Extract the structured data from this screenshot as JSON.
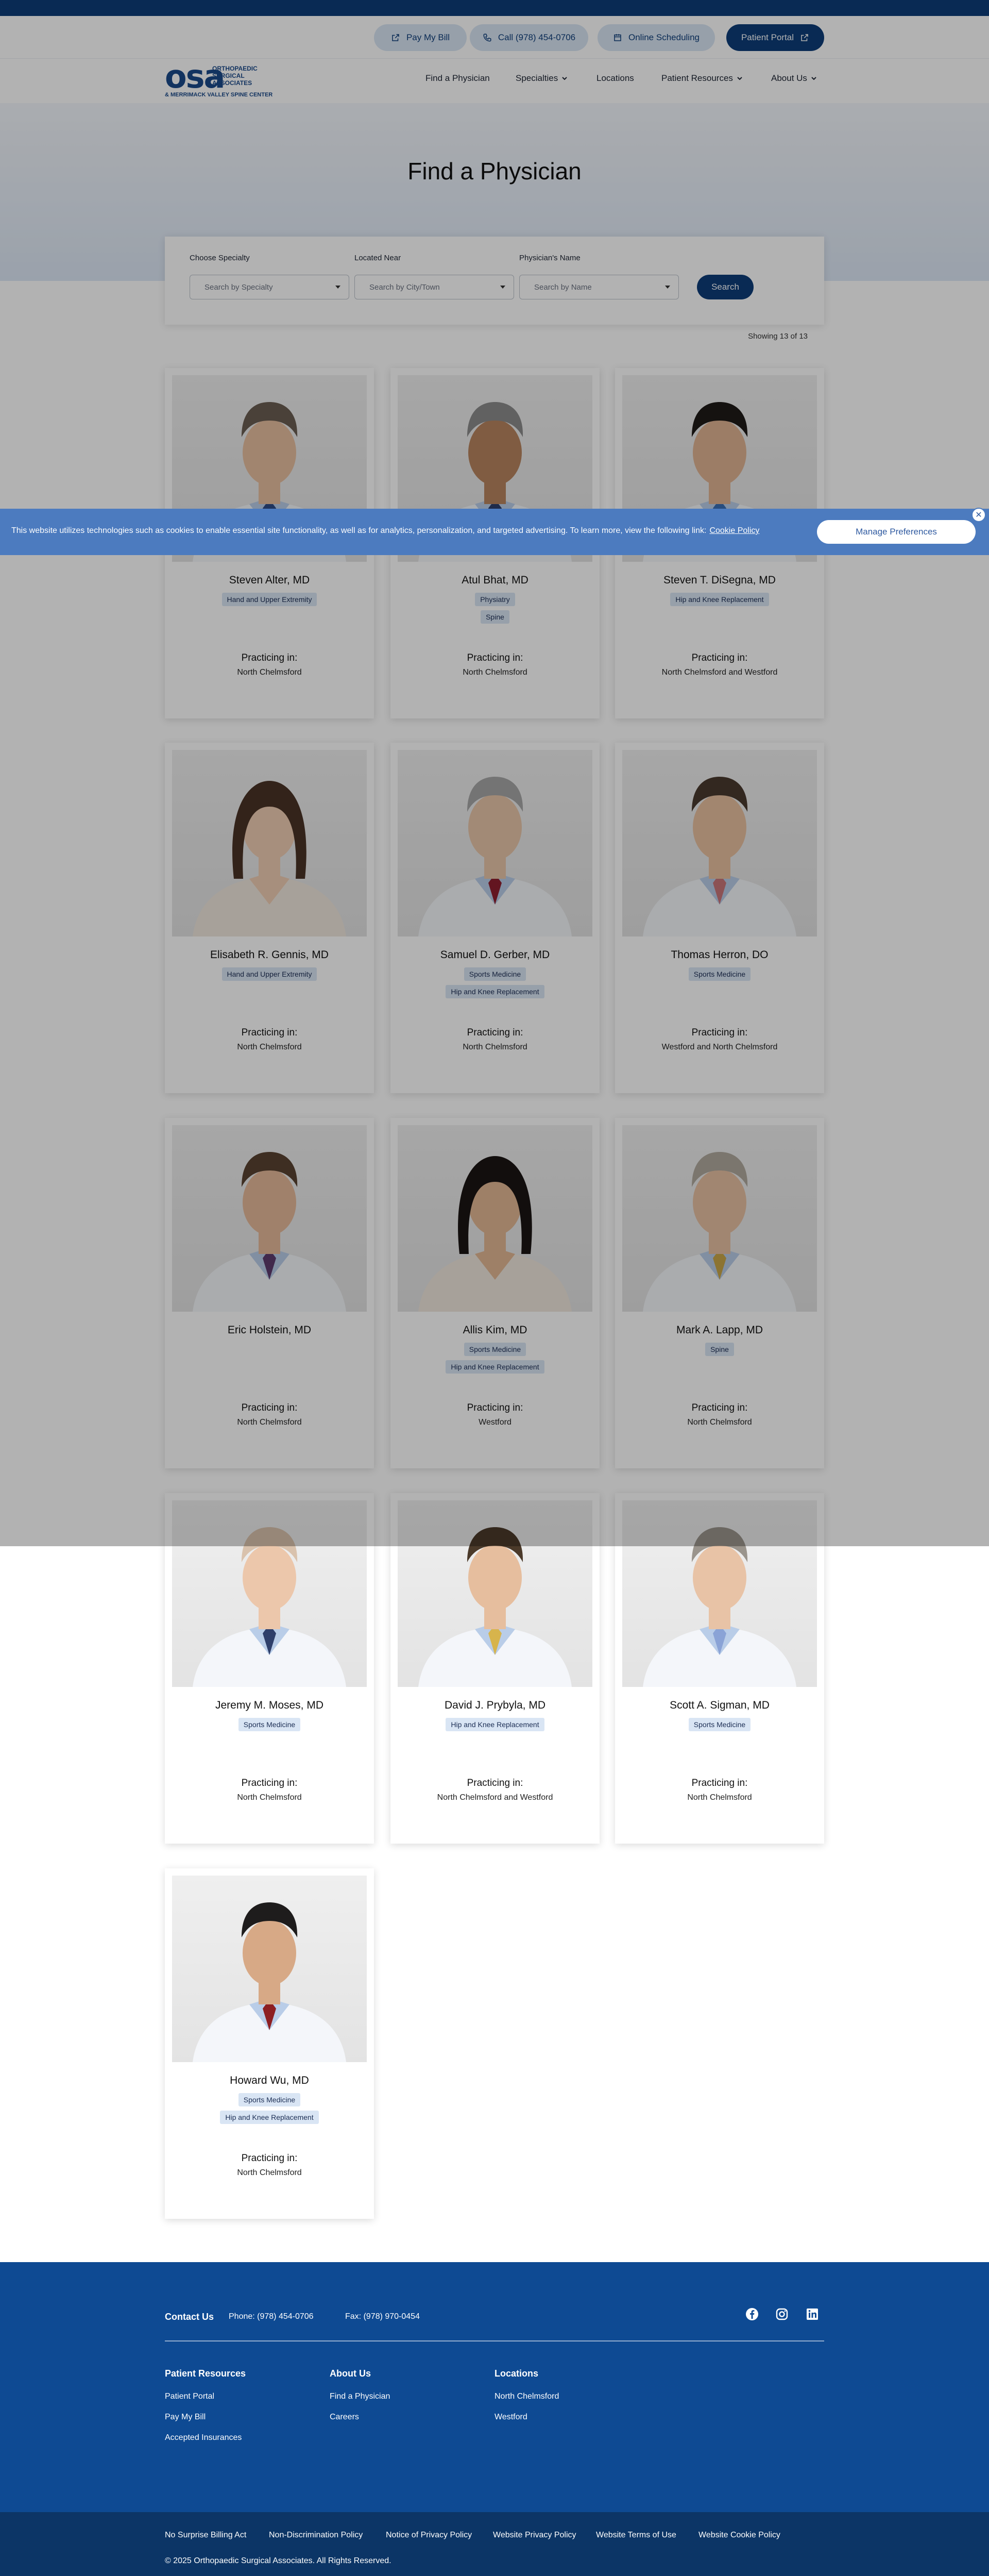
{
  "utility": {
    "pay_bill": "Pay My Bill",
    "call": "Call (978) 454-0706",
    "scheduling": "Online Scheduling",
    "portal": "Patient Portal"
  },
  "logo": {
    "mark": "osa",
    "line1": "ORTHOPAEDIC",
    "line2": "SURGICAL",
    "line3": "ASSOCIATES",
    "sub": "& MERRIMACK VALLEY SPINE CENTER"
  },
  "nav": {
    "find": "Find a Physician",
    "specialties": "Specialties",
    "locations": "Locations",
    "resources": "Patient Resources",
    "about": "About Us"
  },
  "hero": {
    "title": "Find a Physician"
  },
  "filters": {
    "specialty_label": "Choose Specialty",
    "specialty_placeholder": "Search by Specialty",
    "location_label": "Located Near",
    "location_placeholder": "Search by City/Town",
    "name_label": "Physician's Name",
    "name_placeholder": "Search by Name",
    "search_button": "Search"
  },
  "results": {
    "showing": "Showing 13 of 13"
  },
  "practicing_label": "Practicing in:",
  "physicians": [
    {
      "name": "Steven Alter, MD",
      "tags": [
        "Hand and Upper Extremity"
      ],
      "location": "North Chelmsford"
    },
    {
      "name": "Atul Bhat, MD",
      "tags": [
        "Physiatry",
        "Spine"
      ],
      "location": "North Chelmsford"
    },
    {
      "name": "Steven T. DiSegna, MD",
      "tags": [
        "Hip and Knee Replacement"
      ],
      "location": "North Chelmsford and Westford"
    },
    {
      "name": "Elisabeth R. Gennis, MD",
      "tags": [
        "Hand and Upper Extremity"
      ],
      "location": "North Chelmsford"
    },
    {
      "name": "Samuel D. Gerber, MD",
      "tags": [
        "Sports Medicine",
        "Hip and Knee Replacement"
      ],
      "location": "North Chelmsford"
    },
    {
      "name": "Thomas Herron, DO",
      "tags": [
        "Sports Medicine"
      ],
      "location": "Westford and North Chelmsford"
    },
    {
      "name": "Eric Holstein, MD",
      "tags": [],
      "location": "North Chelmsford"
    },
    {
      "name": "Allis Kim, MD",
      "tags": [
        "Sports Medicine",
        "Hip and Knee Replacement"
      ],
      "location": "Westford"
    },
    {
      "name": "Mark A. Lapp, MD",
      "tags": [
        "Spine"
      ],
      "location": "North Chelmsford"
    },
    {
      "name": "Jeremy M. Moses, MD",
      "tags": [
        "Sports Medicine"
      ],
      "location": "North Chelmsford"
    },
    {
      "name": "David J. Prybyla, MD",
      "tags": [
        "Hip and Knee Replacement"
      ],
      "location": "North Chelmsford and Westford"
    },
    {
      "name": "Scott A. Sigman, MD",
      "tags": [
        "Sports Medicine"
      ],
      "location": "North Chelmsford"
    },
    {
      "name": "Howard Wu, MD",
      "tags": [
        "Sports Medicine",
        "Hip and Knee Replacement"
      ],
      "location": "North Chelmsford"
    }
  ],
  "cookie": {
    "text": "This website utilizes technologies such as cookies to enable essential site functionality, as well as for analytics, personalization, and targeted advertising. To learn more, view the following link:",
    "link": "Cookie Policy",
    "button": "Manage Preferences",
    "close": "✕"
  },
  "footer": {
    "contact": "Contact Us",
    "phone": "Phone: (978) 454-0706",
    "fax": "Fax: (978) 970-0454",
    "col1_head": "Patient Resources",
    "col1": [
      "Patient Portal",
      "Pay My Bill",
      "Accepted Insurances"
    ],
    "col2_head": "About Us",
    "col2": [
      "Find a Physician",
      "Careers"
    ],
    "col3_head": "Locations",
    "col3": [
      "North Chelmsford",
      "Westford"
    ],
    "bottom_links": [
      "No Surprise Billing Act",
      "Non-Discrimination Policy",
      "Notice of Privacy Policy",
      "Website Privacy Policy",
      "Website Terms of Use",
      "Website Cookie Policy"
    ],
    "copyright": "© 2025 Orthopaedic Surgical Associates. All Rights Reserved."
  },
  "colors": {
    "navy": "#0d3d79",
    "tag_bg": "#d9e5f4",
    "footer": "#0e4a93",
    "cookie_bar": "#4c7bbf"
  }
}
